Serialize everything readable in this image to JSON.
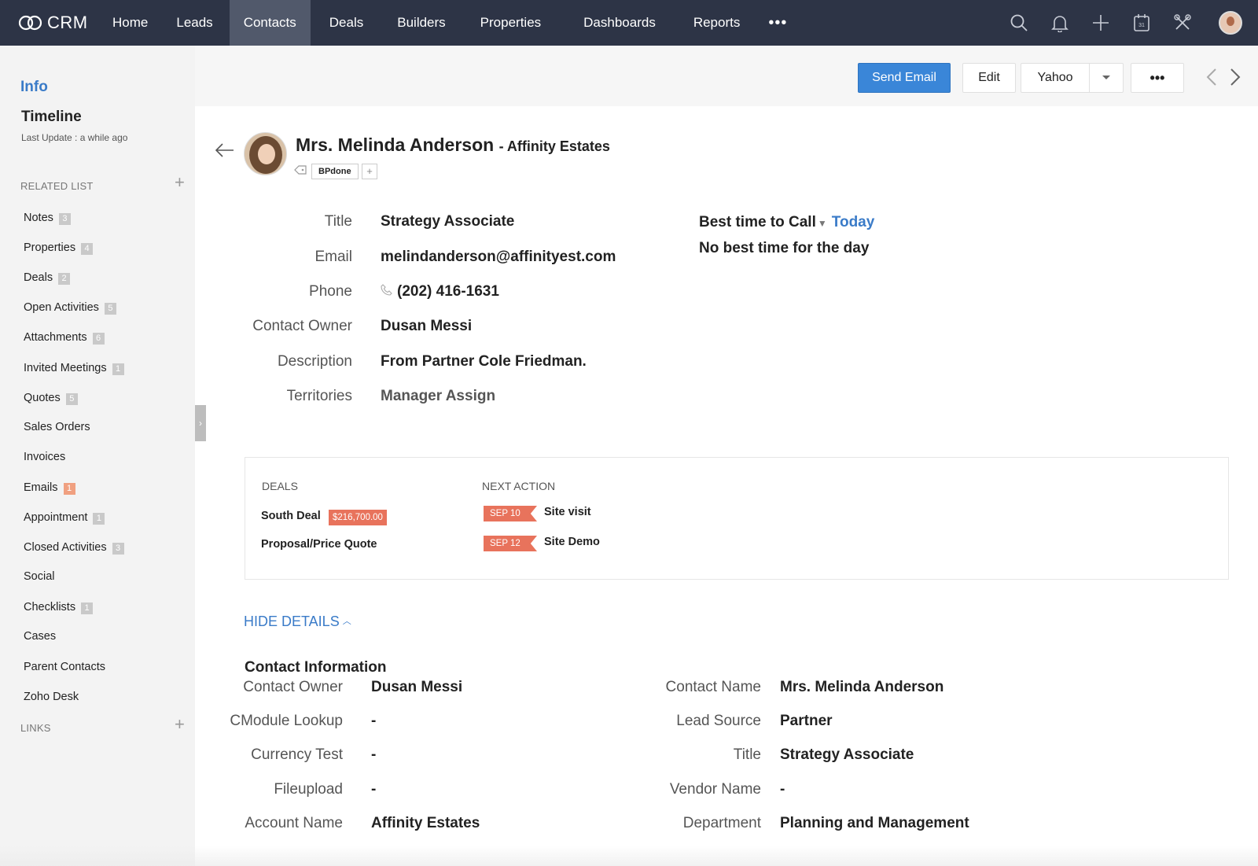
{
  "app": {
    "logo_text": "CRM"
  },
  "nav": {
    "items": [
      "Home",
      "Leads",
      "Contacts",
      "Deals",
      "Builders",
      "Properties",
      "Dashboards",
      "Reports"
    ],
    "active": "Contacts",
    "more": "•••"
  },
  "top_icons": [
    "search-icon",
    "bell-icon",
    "plus-icon",
    "calendar-icon",
    "tools-icon",
    "user-avatar"
  ],
  "sidebar": {
    "info": "Info",
    "timeline": "Timeline",
    "last_update": "Last Update : a while ago",
    "related_list_header": "RELATED LIST",
    "links_header": "LINKS",
    "items": [
      {
        "label": "Notes",
        "count": "3"
      },
      {
        "label": "Properties",
        "count": "4"
      },
      {
        "label": "Deals",
        "count": "2"
      },
      {
        "label": "Open Activities",
        "count": "5"
      },
      {
        "label": "Attachments",
        "count": "6"
      },
      {
        "label": "Invited Meetings",
        "count": "1"
      },
      {
        "label": "Quotes",
        "count": "5"
      },
      {
        "label": "Sales Orders",
        "count": ""
      },
      {
        "label": "Invoices",
        "count": ""
      },
      {
        "label": "Emails",
        "count": "1",
        "highlight": true
      },
      {
        "label": "Appointment",
        "count": "1"
      },
      {
        "label": "Closed Activities",
        "count": "3"
      },
      {
        "label": "Social",
        "count": ""
      },
      {
        "label": "Checklists",
        "count": "1"
      },
      {
        "label": "Cases",
        "count": ""
      },
      {
        "label": "Parent Contacts",
        "count": ""
      },
      {
        "label": "Zoho Desk",
        "count": ""
      }
    ]
  },
  "actions": {
    "send_email": "Send Email",
    "edit": "Edit",
    "provider": "Yahoo",
    "more": "•••"
  },
  "contact": {
    "name": "Mrs. Melinda Anderson",
    "account_suffix": "- Affinity Estates",
    "tag": "BPdone",
    "fields": [
      {
        "label": "Title",
        "value": "Strategy Associate"
      },
      {
        "label": "Email",
        "value": "melindanderson@affinityest.com"
      },
      {
        "label": "Phone",
        "value": "(202) 416-1631"
      },
      {
        "label": "Contact Owner",
        "value": "Dusan Messi"
      },
      {
        "label": "Description",
        "value": "From Partner Cole Friedman."
      },
      {
        "label": "Territories",
        "value": "Manager Assign"
      }
    ],
    "best_time_label": "Best time to Call",
    "best_time_option": "Today",
    "best_time_value": "No best time for the day"
  },
  "deals_box": {
    "deals_header": "DEALS",
    "next_action_header": "NEXT ACTION",
    "deals": [
      {
        "name": "South Deal",
        "amount": "$216,700.00"
      },
      {
        "name": "Proposal/Price Quote",
        "amount": ""
      }
    ],
    "actions": [
      {
        "date": "SEP 10",
        "text": "Site visit"
      },
      {
        "date": "SEP 12",
        "text": "Site Demo"
      }
    ]
  },
  "hide_details": "HIDE DETAILS",
  "contact_info": {
    "title": "Contact Information",
    "left": [
      {
        "label": "Contact Owner",
        "value": "Dusan Messi"
      },
      {
        "label": "CModule Lookup",
        "value": "-"
      },
      {
        "label": "Currency Test",
        "value": "-"
      },
      {
        "label": "Fileupload",
        "value": "-"
      },
      {
        "label": "Account Name",
        "value": "Affinity Estates"
      }
    ],
    "right": [
      {
        "label": "Contact Name",
        "value": "Mrs. Melinda Anderson"
      },
      {
        "label": "Lead Source",
        "value": "Partner"
      },
      {
        "label": "Title",
        "value": "Strategy Associate"
      },
      {
        "label": "Vendor Name",
        "value": "-"
      },
      {
        "label": "Department",
        "value": "Planning and Management"
      }
    ]
  },
  "colors": {
    "topbar": "#2d3446",
    "accent": "#3a86d8",
    "tag_orange": "#e8735c"
  }
}
